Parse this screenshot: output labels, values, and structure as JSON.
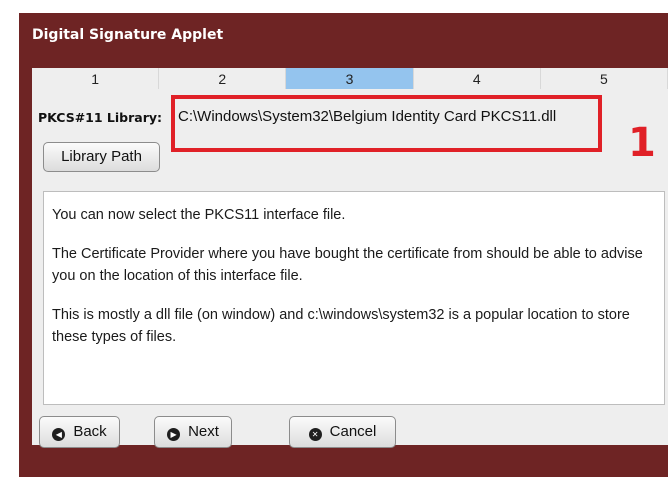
{
  "window": {
    "title": "Digital Signature Applet"
  },
  "steps": [
    "1",
    "2",
    "3",
    "4",
    "5"
  ],
  "active_step": "3",
  "pkcs": {
    "label": "PKCS#11 Library:",
    "value": "C:\\Windows\\System32\\Belgium Identity Card PKCS11.dll"
  },
  "buttons": {
    "library_path": "Library Path",
    "back": "Back",
    "next": "Next",
    "cancel": "Cancel"
  },
  "info": {
    "p1": "You can now select the PKCS11 interface file.",
    "p2": "The Certificate Provider where you have bought the certificate from should be able to advise you on the location of this interface file.",
    "p3": "This is mostly a dll file (on window) and c:\\windows\\system32 is a popular location to store these types of files."
  },
  "annotation": {
    "number": "1",
    "color": "#e02027"
  },
  "colors": {
    "window_bg": "#6e2424",
    "active_step": "#94c4ee"
  },
  "icons": {
    "back": "arrow-left-icon",
    "next": "arrow-right-icon",
    "cancel": "close-icon"
  }
}
